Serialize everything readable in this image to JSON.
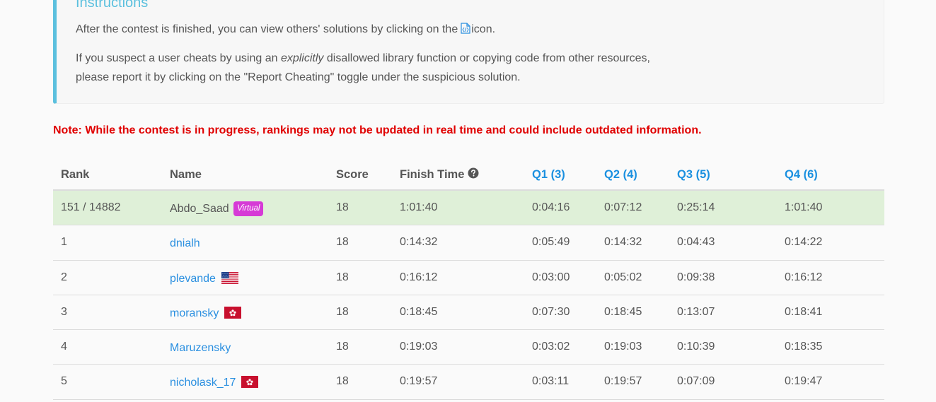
{
  "instructions": {
    "title": "Instructions",
    "line1_before": "After the contest is finished, you can view others' solutions by clicking on the",
    "line1_after": "icon.",
    "line2_before": "If you suspect a user cheats by using an ",
    "line2_em": "explicitly",
    "line2_after": " disallowed library function or copying code from other resources,",
    "line3": "please report it by clicking on the \"Report Cheating\" toggle under the suspicious solution.",
    "code_icon": "code-file-icon"
  },
  "note": "Note: While the contest is in progress, rankings may not be updated in real time and could include outdated information.",
  "table": {
    "headers": {
      "rank": "Rank",
      "name": "Name",
      "score": "Score",
      "finish": "Finish Time",
      "q1": "Q1 (3)",
      "q2": "Q2 (4)",
      "q3": "Q3 (5)",
      "q4": "Q4 (6)"
    },
    "help_icon": "question-circle-icon",
    "highlight_color": "#dff0d8",
    "link_color": "#2a8fe0",
    "current_user": {
      "rank": "151 / 14882",
      "name": "Abdo_Saad",
      "badge": "Virtual",
      "score": "18",
      "finish": "1:01:40",
      "q1": "0:04:16",
      "q2": "0:07:12",
      "q3": "0:25:14",
      "q4": "1:01:40"
    },
    "rows": [
      {
        "rank": "1",
        "name": "dnialh",
        "flag": "",
        "score": "18",
        "finish": "0:14:32",
        "q1": "0:05:49",
        "q2": "0:14:32",
        "q3": "0:04:43",
        "q4": "0:14:22"
      },
      {
        "rank": "2",
        "name": "plevande",
        "flag": "us-flag-icon",
        "score": "18",
        "finish": "0:16:12",
        "q1": "0:03:00",
        "q2": "0:05:02",
        "q3": "0:09:38",
        "q4": "0:16:12"
      },
      {
        "rank": "3",
        "name": "moransky",
        "flag": "hk-flag-icon",
        "score": "18",
        "finish": "0:18:45",
        "q1": "0:07:30",
        "q2": "0:18:45",
        "q3": "0:13:07",
        "q4": "0:18:41"
      },
      {
        "rank": "4",
        "name": "Maruzensky",
        "flag": "",
        "score": "18",
        "finish": "0:19:03",
        "q1": "0:03:02",
        "q2": "0:19:03",
        "q3": "0:10:39",
        "q4": "0:18:35"
      },
      {
        "rank": "5",
        "name": "nicholask_17",
        "flag": "hk-flag-icon",
        "score": "18",
        "finish": "0:19:57",
        "q1": "0:03:11",
        "q2": "0:19:57",
        "q3": "0:07:09",
        "q4": "0:19:47"
      }
    ]
  }
}
